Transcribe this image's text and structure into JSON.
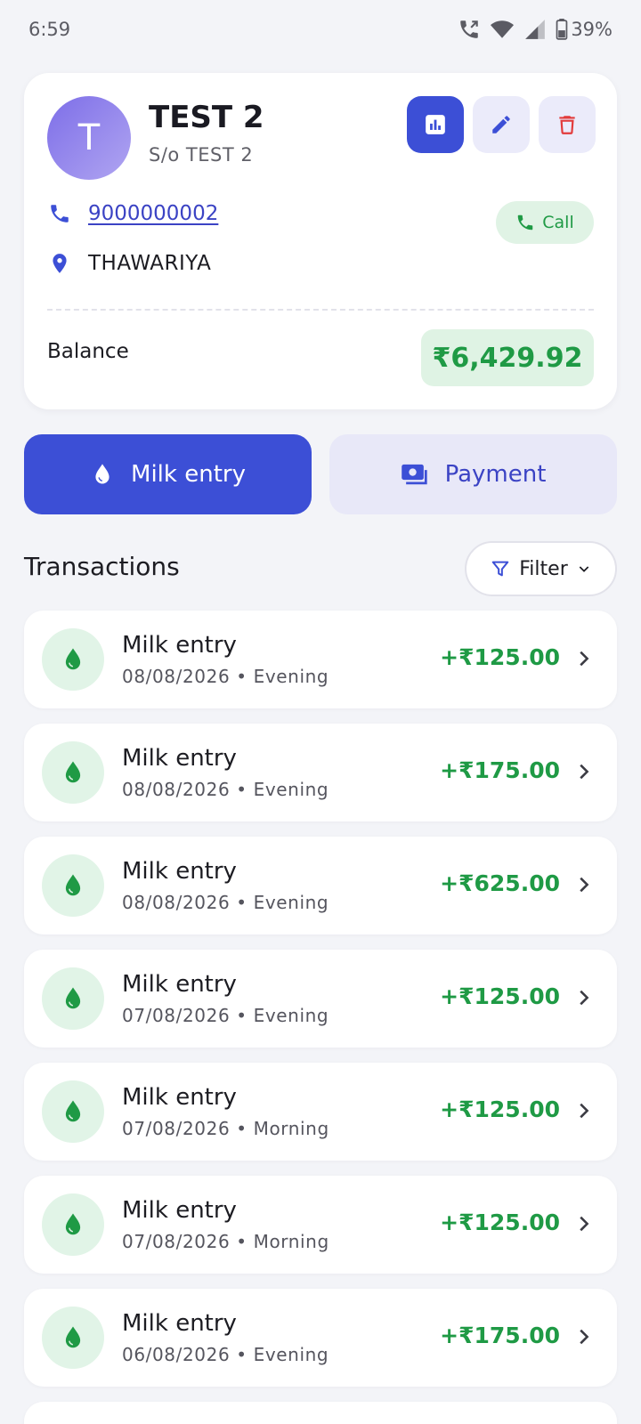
{
  "status_bar": {
    "time": "6:59",
    "battery": "39%"
  },
  "profile": {
    "avatar_letter": "T",
    "name": "TEST 2",
    "relation": "S/o TEST 2",
    "phone": "9000000002",
    "address": "THAWARIYA",
    "call_label": "Call",
    "balance_label": "Balance",
    "balance_value": "₹6,429.92"
  },
  "actions": {
    "milk_entry_label": "Milk entry",
    "payment_label": "Payment"
  },
  "transactions": {
    "title": "Transactions",
    "filter_label": "Filter",
    "items": [
      {
        "title": "Milk entry",
        "meta": "08/08/2026 • Evening",
        "amount": "+₹125.00"
      },
      {
        "title": "Milk entry",
        "meta": "08/08/2026 • Evening",
        "amount": "+₹175.00"
      },
      {
        "title": "Milk entry",
        "meta": "08/08/2026 • Evening",
        "amount": "+₹625.00"
      },
      {
        "title": "Milk entry",
        "meta": "07/08/2026 • Evening",
        "amount": "+₹125.00"
      },
      {
        "title": "Milk entry",
        "meta": "07/08/2026 • Morning",
        "amount": "+₹125.00"
      },
      {
        "title": "Milk entry",
        "meta": "07/08/2026 • Morning",
        "amount": "+₹125.00"
      },
      {
        "title": "Milk entry",
        "meta": "06/08/2026 • Evening",
        "amount": "+₹175.00"
      }
    ]
  },
  "colors": {
    "primary": "#3c4fd6",
    "positive": "#1f9a45",
    "danger": "#e23b3b",
    "background": "#f3f4f8"
  },
  "icons": {
    "report": "bar-chart-icon",
    "edit": "pencil-icon",
    "delete": "trash-icon",
    "phone": "phone-icon",
    "location": "location-pin-icon",
    "milk": "droplet-icon",
    "payment": "cash-icon",
    "filter": "funnel-icon",
    "row_chevron": "chevron-right-icon"
  }
}
